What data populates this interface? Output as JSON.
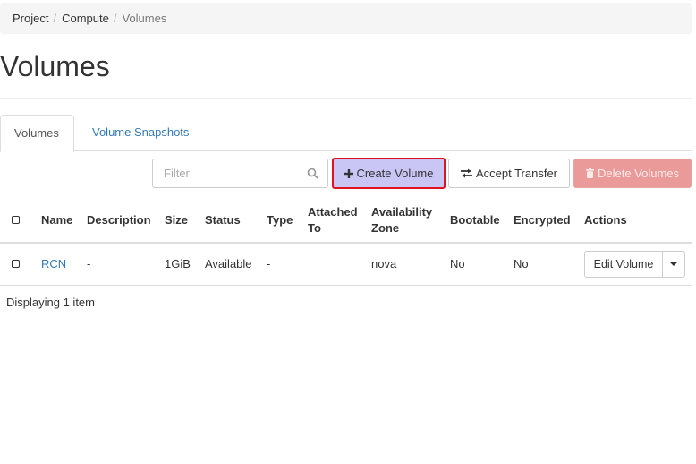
{
  "breadcrumb": {
    "items": [
      "Project",
      "Compute",
      "Volumes"
    ]
  },
  "page": {
    "title": "Volumes"
  },
  "tabs": [
    {
      "label": "Volumes",
      "active": true
    },
    {
      "label": "Volume Snapshots",
      "active": false
    }
  ],
  "toolbar": {
    "filter_placeholder": "Filter",
    "create_label": "Create Volume",
    "accept_label": "Accept Transfer",
    "delete_label": "Delete Volumes"
  },
  "table": {
    "headers": {
      "name": "Name",
      "description": "Description",
      "size": "Size",
      "status": "Status",
      "type": "Type",
      "attached_line1": "Attached",
      "attached_line2": "To",
      "az_line1": "Availability",
      "az_line2": "Zone",
      "bootable": "Bootable",
      "encrypted": "Encrypted",
      "actions": "Actions"
    },
    "rows": [
      {
        "name": "RCN",
        "description": "-",
        "size": "1GiB",
        "status": "Available",
        "type": "-",
        "attached_to": "",
        "availability_zone": "nova",
        "bootable": "No",
        "encrypted": "No",
        "action_label": "Edit Volume"
      }
    ]
  },
  "footer": {
    "count_text": "Displaying 1 item"
  },
  "colors": {
    "link": "#337ab7",
    "highlight_border": "#e0121d",
    "create_bg": "#c9c5f5",
    "delete_bg": "#e99a99"
  },
  "icons": {
    "create": "plus-icon",
    "accept": "exchange-icon",
    "delete": "trash-icon",
    "filter": "search-icon"
  }
}
